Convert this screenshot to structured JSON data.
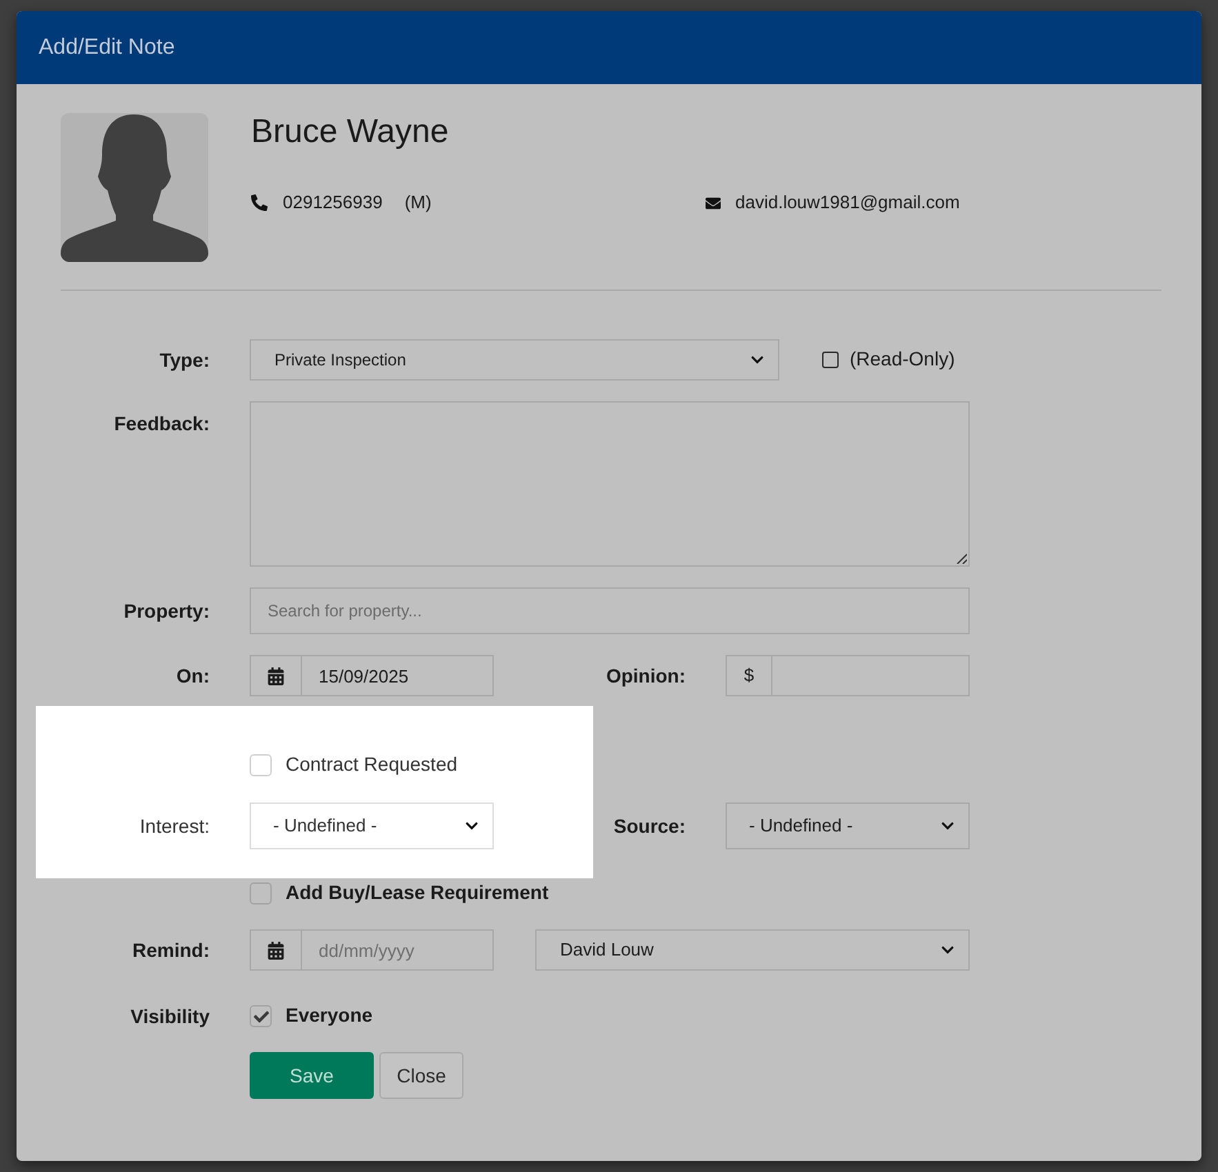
{
  "dialog": {
    "title": "Add/Edit Note"
  },
  "contact": {
    "name": "Bruce Wayne",
    "phone": "0291256939",
    "phone_type": "(M)",
    "email": "david.louw1981@gmail.com"
  },
  "form": {
    "type": {
      "label": "Type:",
      "value": "Private Inspection"
    },
    "read_only": {
      "label": "(Read-Only)",
      "checked": false
    },
    "feedback": {
      "label": "Feedback:"
    },
    "property": {
      "label": "Property:",
      "placeholder": "Search for property..."
    },
    "on": {
      "label": "On:",
      "value": "15/09/2025"
    },
    "opinion": {
      "label": "Opinion:",
      "prefix": "$"
    },
    "interest_group": {
      "highlighted": true,
      "contract_requested": {
        "label": "Contract Requested",
        "checked": false
      },
      "interest": {
        "label": "Interest:",
        "value": "- Undefined -"
      }
    },
    "source": {
      "label": "Source:",
      "value": "- Undefined -"
    },
    "add_requirement": {
      "label": "Add Buy/Lease Requirement",
      "checked": false
    },
    "remind": {
      "label": "Remind:",
      "placeholder": "dd/mm/yyyy",
      "assignee": "David Louw"
    },
    "visibility": {
      "label": "Visibility",
      "option": "Everyone",
      "checked": true
    }
  },
  "buttons": [
    {
      "label": "Save",
      "kind": "primary"
    },
    {
      "label": "Close",
      "kind": "secondary"
    }
  ]
}
